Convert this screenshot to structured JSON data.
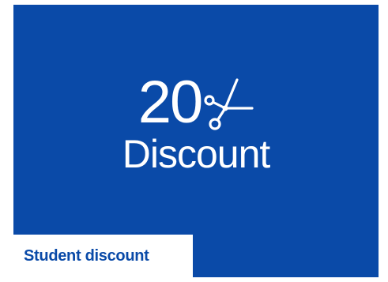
{
  "card": {
    "background_color": "#0a4aa8",
    "promo": {
      "number": "20",
      "icon": "scissors-icon",
      "label": "Discount"
    },
    "tag": {
      "label": "Student discount",
      "text_color": "#0a4aa8",
      "background_color": "#ffffff"
    }
  }
}
